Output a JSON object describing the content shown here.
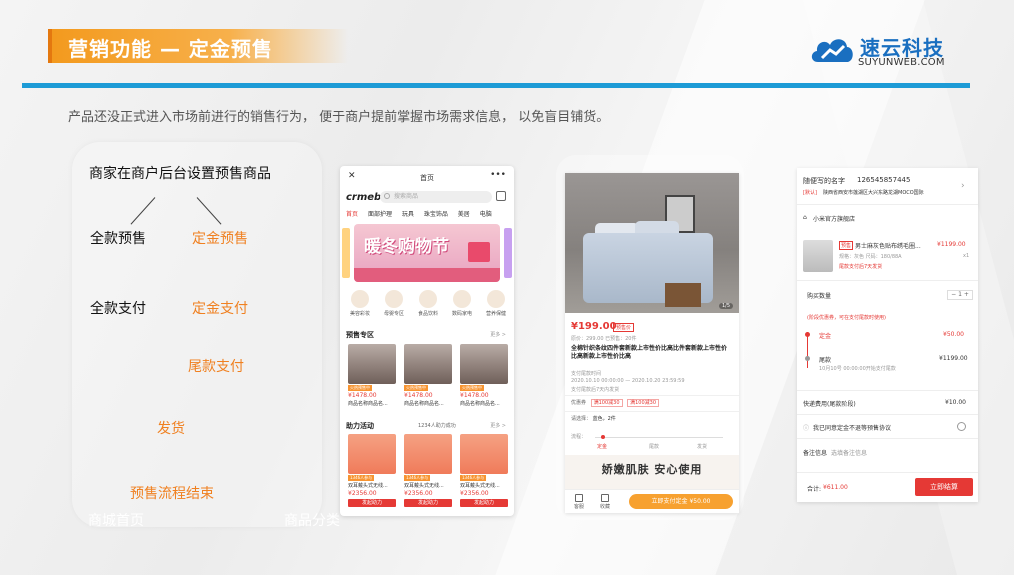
{
  "header": {
    "title": "营销功能 — 定金预售",
    "logo_cn": "速云科技",
    "logo_en": "SUYUNWEB.COM"
  },
  "intro": "产品还没正式进入市场前进行的销售行为，  便于商户提前掌握市场需求信息，   以免盲目铺货。",
  "flow": {
    "step_setup": "商家在商户后台设置预售商品",
    "full_presale": "全款预售",
    "deposit_presale": "定金预售",
    "full_payment": "全款支付",
    "deposit_payment": "定金支付",
    "balance_payment": "尾款支付",
    "shipping": "发货",
    "end": "预售流程结束",
    "caption_home": "商城首页",
    "caption_category": "商品分类"
  },
  "phone1": {
    "nav_title": "首页",
    "brand": "crmeb",
    "search_placeholder": "搜索商品",
    "categories": [
      "首页",
      "面部护理",
      "玩具",
      "珠宝饰品",
      "美居",
      "电脑"
    ],
    "banner_text": "暖冬购物节",
    "icons": [
      "美容彩妆",
      "母婴专区",
      "食品饮料",
      "数码家电",
      "营养保健"
    ],
    "presale_section": "预售专区",
    "more": "更多 >",
    "presale_items": [
      {
        "tag": "火热预售中",
        "price": "¥1478.00",
        "name": "商品名称商品名..."
      },
      {
        "tag": "火热预售中",
        "price": "¥1478.00",
        "name": "商品名称商品名..."
      },
      {
        "tag": "火热预售中",
        "price": "¥1478.00",
        "name": "商品名称商品名..."
      }
    ],
    "assist_section": "助力活动",
    "assist_count": "1234人助力成功",
    "assist_items": [
      {
        "tag": "1346人参与",
        "name": "双耳戴头式无线...",
        "price": "¥2356.00",
        "btn": "发起助力"
      },
      {
        "tag": "1346人参与",
        "name": "双耳戴头式无线...",
        "price": "¥2356.00",
        "btn": "发起助力"
      },
      {
        "tag": "1346人参与",
        "name": "双耳戴头式无线...",
        "price": "¥2356.00",
        "btn": "发起助力"
      }
    ]
  },
  "phone2": {
    "photo_count": "1/5",
    "price": "¥199.00",
    "tag": "预售价",
    "sub": "原价：299.00   已预售：20件",
    "title": "全棉针织条纹四件套新款上市性价比高比件套新款上市性价比高新款上市性价比高",
    "presale_time_label": "支付尾款时间",
    "time_range": "2020.10.10  00:00:00  —  2020.10.20  23:59:59",
    "ship_note": "支付尾款后7天内发货",
    "promo_label": "优惠券",
    "promo_chips": [
      "满100减30",
      "满100减30"
    ],
    "choose_label": "请选择：",
    "choose_value": "蓝色，2件",
    "flow_label": "流程：",
    "flow_steps": [
      "定金",
      "尾款",
      "发货"
    ],
    "ad_text": "娇嫩肌肤  安心使用",
    "bottom_icons": [
      "客服",
      "收藏"
    ],
    "buy_button": "立即支付定金 ¥50.00"
  },
  "phone3": {
    "name": "随便写的名字",
    "phone": "126545857445",
    "address_tag": "[默认]",
    "address": "陕西省西安市莲湖区大兴东路龙湖MOCO国际",
    "store": "小米官方旗舰店",
    "item_tag": "预售",
    "item_name": "男士麻灰色贴布绣毛圈...",
    "item_price": "¥1199.00",
    "item_spec": "规格：灰色  尺码：180/88A",
    "item_qty": "x1",
    "item_note": "尾款支付后7天发货",
    "qty_label": "购买数量",
    "qty_value": "1",
    "notice": "(阶段优惠券，可在支付尾款时使用)",
    "deposit_label": "定金",
    "deposit_value": "¥50.00",
    "balance_label": "尾款",
    "balance_value": "¥1199.00",
    "balance_time": "10月10号 00:00:00开始支付尾款",
    "shipping_label": "快递费用(尾款阶段)",
    "shipping_value": "¥10.00",
    "agree": "我已同意定金不退等预售协议",
    "remark_label": "备注信息",
    "remark_placeholder": "选填备注信息",
    "total_label": "合计:",
    "total_value": "¥611.00",
    "pay_button": "立即结算"
  }
}
